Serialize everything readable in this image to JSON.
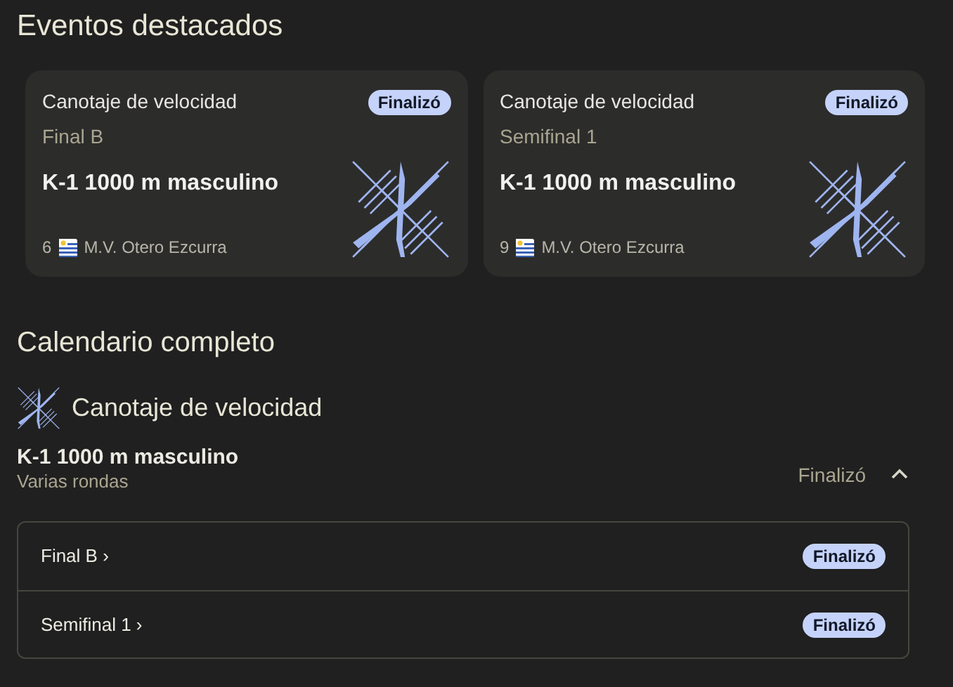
{
  "title": "Eventos destacados",
  "featured": [
    {
      "sport": "Canotaje de velocidad",
      "badge": "Finalizó",
      "round": "Final B",
      "event": "K-1 1000 m masculino",
      "rank": "6",
      "athlete": "M.V. Otero Ezcurra"
    },
    {
      "sport": "Canotaje de velocidad",
      "badge": "Finalizó",
      "round": "Semifinal 1",
      "event": "K-1 1000 m masculino",
      "rank": "9",
      "athlete": "M.V. Otero Ezcurra"
    }
  ],
  "calendar": {
    "title": "Calendario completo",
    "sport": "Canotaje de velocidad",
    "event": {
      "name": "K-1 1000 m masculino",
      "subtitle": "Varias rondas",
      "status": "Finalizó",
      "expanded": true,
      "rounds": [
        {
          "label": "Final B ›",
          "badge": "Finalizó"
        },
        {
          "label": "Semifinal 1 ›",
          "badge": "Finalizó"
        }
      ]
    }
  }
}
